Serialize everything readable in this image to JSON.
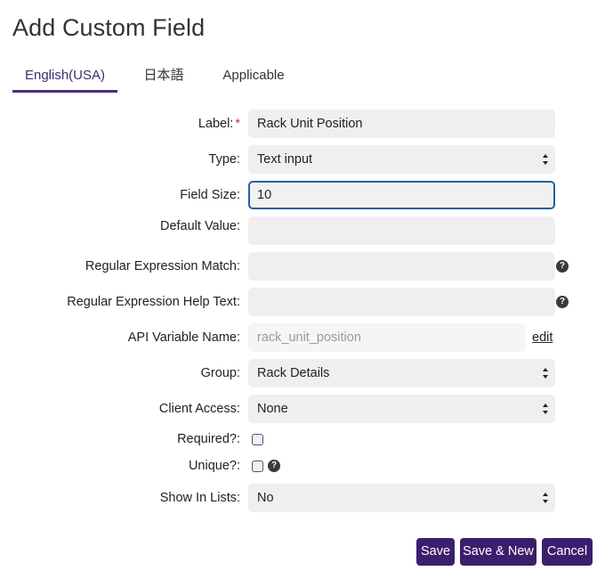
{
  "page": {
    "title": "Add Custom Field"
  },
  "tabs": [
    {
      "label": "English(USA)",
      "active": true
    },
    {
      "label": "日本語",
      "active": false
    },
    {
      "label": "Applicable",
      "active": false
    }
  ],
  "form": {
    "label": {
      "label": "Label:",
      "required_mark": "*",
      "value": "Rack Unit Position"
    },
    "type": {
      "label": "Type:",
      "value": "Text input"
    },
    "field_size": {
      "label": "Field Size:",
      "value": "10"
    },
    "default_value": {
      "label": "Default Value:",
      "value": ""
    },
    "regex_match": {
      "label": "Regular Expression Match:",
      "value": "",
      "help_icon": "question-icon"
    },
    "regex_help": {
      "label": "Regular Expression Help Text:",
      "value": "",
      "help_icon": "question-icon"
    },
    "api_var": {
      "label": "API Variable Name:",
      "placeholder": "rack_unit_position",
      "edit_label": "edit"
    },
    "group": {
      "label": "Group:",
      "value": "Rack Details"
    },
    "client_access": {
      "label": "Client Access:",
      "value": "None"
    },
    "required": {
      "label": "Required?:",
      "checked": false
    },
    "unique": {
      "label": "Unique?:",
      "checked": false,
      "help_icon": "question-icon"
    },
    "show_in_lists": {
      "label": "Show In Lists:",
      "value": "No"
    }
  },
  "buttons": {
    "save": "Save",
    "save_new": "Save & New",
    "cancel": "Cancel"
  },
  "colors": {
    "primary": "#3b1f6e",
    "required": "#d32f2f",
    "focus": "#2b5f9e"
  }
}
